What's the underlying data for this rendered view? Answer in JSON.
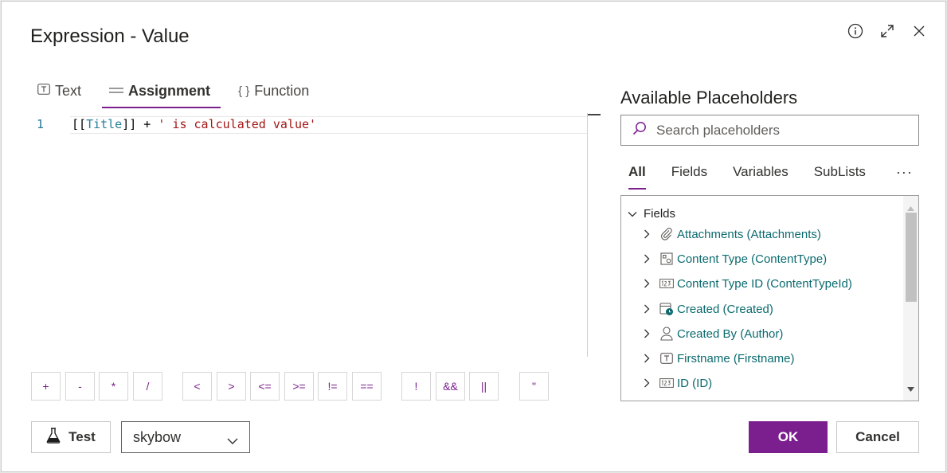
{
  "dialog": {
    "title": "Expression - Value"
  },
  "tabs": [
    {
      "label": "Text",
      "icon": "text-box-icon"
    },
    {
      "label": "Assignment",
      "icon": "equals-icon"
    },
    {
      "label": "Function",
      "icon": "braces-icon"
    }
  ],
  "editor": {
    "line_number": "1",
    "code_open": "[[",
    "code_field": "Title",
    "code_close": "]] + ",
    "code_string": "' is calculated value'"
  },
  "operators": [
    "+",
    "-",
    "*",
    "/",
    "<",
    ">",
    "<=",
    ">=",
    "!=",
    "==",
    "!",
    "&&",
    "||",
    "\""
  ],
  "test": {
    "label": "Test"
  },
  "site_select": {
    "value": "skybow"
  },
  "placeholders": {
    "title": "Available Placeholders",
    "search_placeholder": "Search placeholders",
    "tabs": [
      "All",
      "Fields",
      "Variables",
      "SubLists"
    ],
    "more": "···",
    "group": "Fields",
    "items": [
      {
        "label": "Attachments (Attachments)",
        "icon": "paperclip-icon"
      },
      {
        "label": "Content Type (ContentType)",
        "icon": "content-type-icon"
      },
      {
        "label": "Content Type ID (ContentTypeId)",
        "icon": "number-icon"
      },
      {
        "label": "Created (Created)",
        "icon": "calendar-clock-icon"
      },
      {
        "label": "Created By (Author)",
        "icon": "person-icon"
      },
      {
        "label": "Firstname (Firstname)",
        "icon": "text-box-icon"
      },
      {
        "label": "ID (ID)",
        "icon": "number-icon"
      }
    ]
  },
  "actions": {
    "ok": "OK",
    "cancel": "Cancel"
  },
  "colors": {
    "accent": "#7b1f8e",
    "link": "#0b6a6f"
  }
}
